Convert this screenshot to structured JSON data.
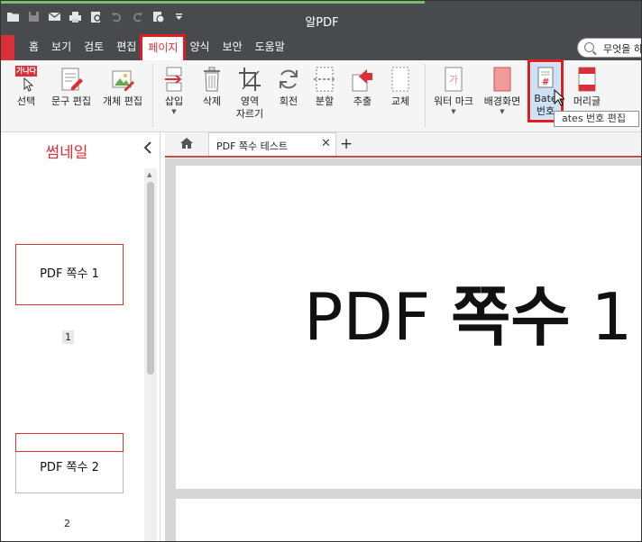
{
  "app": {
    "title": "알PDF",
    "quick_access": [
      "folder-icon",
      "save-icon",
      "email-icon",
      "print-icon",
      "preview-icon",
      "undo-icon",
      "redo-icon",
      "settings-icon",
      "more-icon"
    ]
  },
  "menu": {
    "items": [
      "홈",
      "보기",
      "검토",
      "편집",
      "페이지",
      "양식",
      "보안",
      "도움말"
    ],
    "active": "페이지"
  },
  "search": {
    "placeholder": "무엇을 하"
  },
  "ribbon": {
    "badge_text": "가나다",
    "buttons": {
      "select": "선택",
      "text_edit": "문구 편집",
      "object_edit": "개체 편집",
      "insert": "삽입",
      "delete": "삭제",
      "crop_line1": "영역",
      "crop_line2": "자르기",
      "rotate": "회전",
      "split": "분할",
      "extract": "추출",
      "replace": "교체",
      "watermark": "워터 마크",
      "background": "배경화면",
      "bates_line1": "Bate",
      "bates_line2": "번호",
      "header": "머리글"
    },
    "tooltip": "ates 번호 편집"
  },
  "thumbnails": {
    "title": "썸네일",
    "pages": [
      {
        "label": "PDF 쪽수 1",
        "number": "1"
      },
      {
        "label": "PDF 쪽수 2",
        "number": "2"
      }
    ]
  },
  "document": {
    "tab_title": "PDF 쪽수 테스트",
    "page_latin": "PDF ",
    "page_korean": "쪽수",
    "page_number": " 1"
  },
  "colors": {
    "accent": "#d9303a",
    "highlight": "#e21d22",
    "title_bar": "#494a4e",
    "ribbon": "#f5f5f5"
  }
}
